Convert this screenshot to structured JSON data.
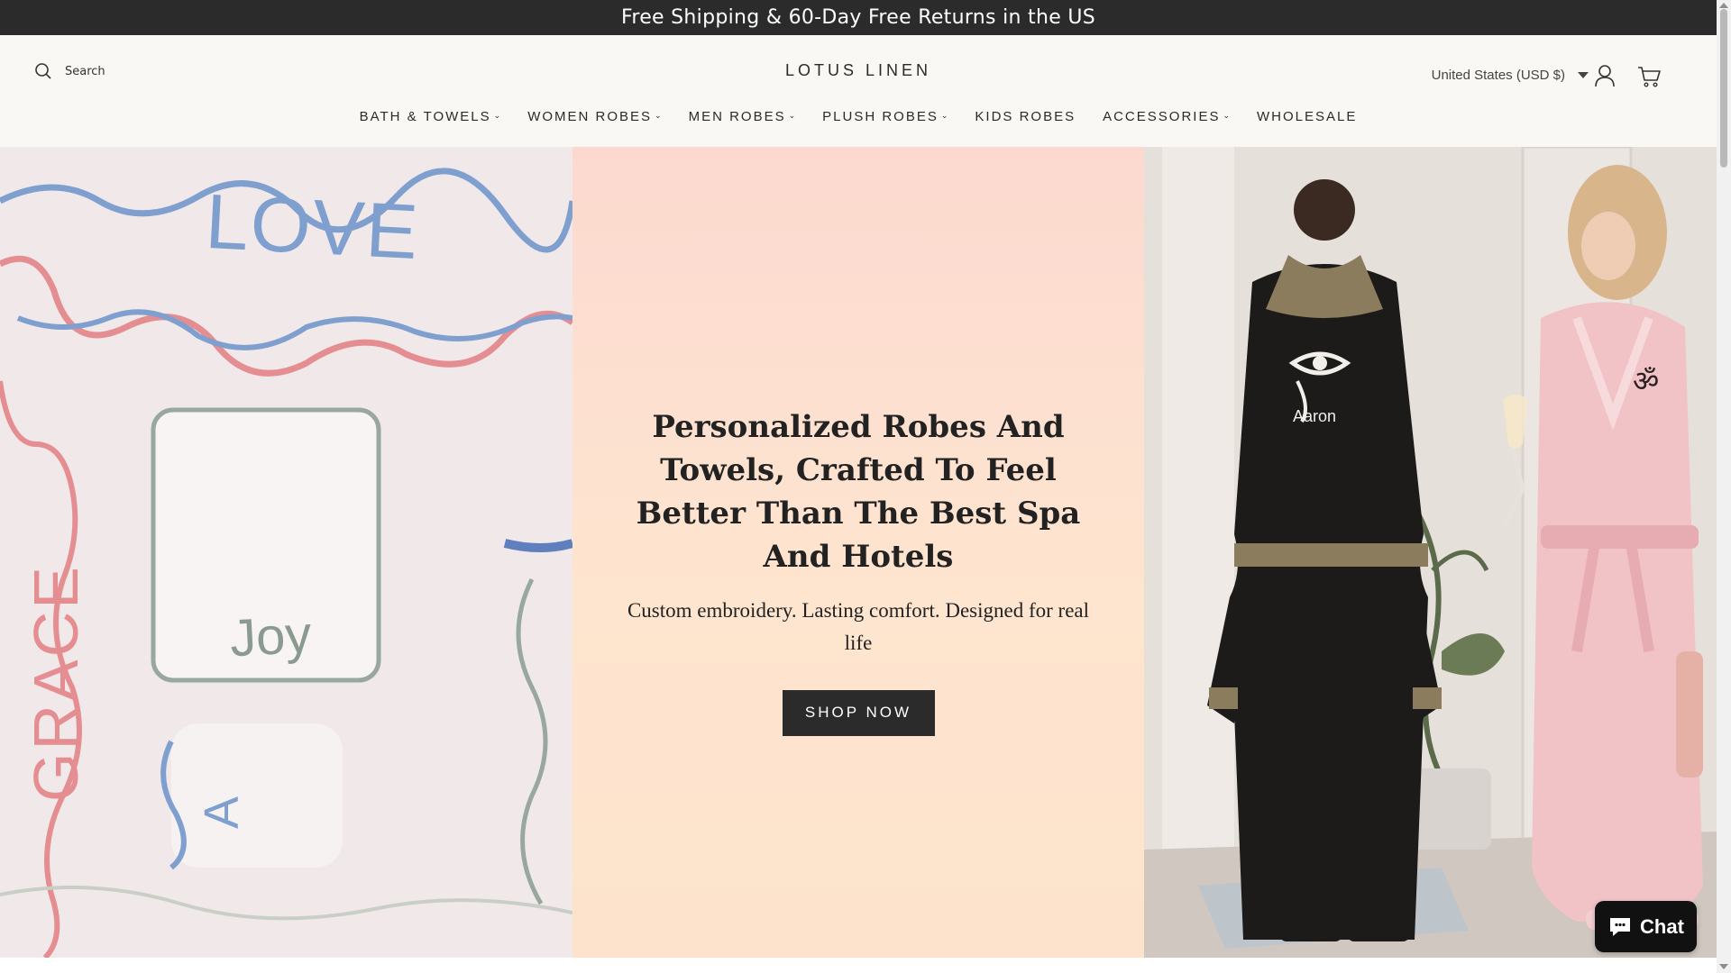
{
  "announcement": {
    "text": "Free Shipping & 60-Day Free Returns in the US"
  },
  "header": {
    "search_label": "Search",
    "brand": "LOTUS LINEN",
    "currency": "United States (USD $)"
  },
  "nav": {
    "items": [
      {
        "label": "BATH & TOWELS",
        "has_dropdown": true
      },
      {
        "label": "WOMEN ROBES",
        "has_dropdown": true
      },
      {
        "label": "MEN ROBES",
        "has_dropdown": true
      },
      {
        "label": "PLUSH ROBES",
        "has_dropdown": true
      },
      {
        "label": "KIDS ROBES",
        "has_dropdown": false
      },
      {
        "label": "ACCESSORIES",
        "has_dropdown": true
      },
      {
        "label": "WHOLESALE",
        "has_dropdown": false
      }
    ],
    "dropdown_glyph": "⌄"
  },
  "hero": {
    "title": "Personalized Robes And Towels, Crafted To Feel Better Than The Best Spa And Hotels",
    "subtitle": "Custom embroidery. Lasting comfort. Designed for real life",
    "cta_label": "SHOP NOW",
    "left_image_words": {
      "love": "LOVE",
      "grace": "GRACE",
      "joy": "Joy",
      "letter": "A"
    },
    "right_image_words": {
      "robe_name": "Aaron",
      "om": "ॐ"
    }
  },
  "chat": {
    "label": "Chat"
  },
  "colors": {
    "topbar": "#2b2b2b",
    "header_bg": "#faf8f4",
    "button_bg": "#2b2b2b",
    "hero_mid": "#fde0d0"
  }
}
